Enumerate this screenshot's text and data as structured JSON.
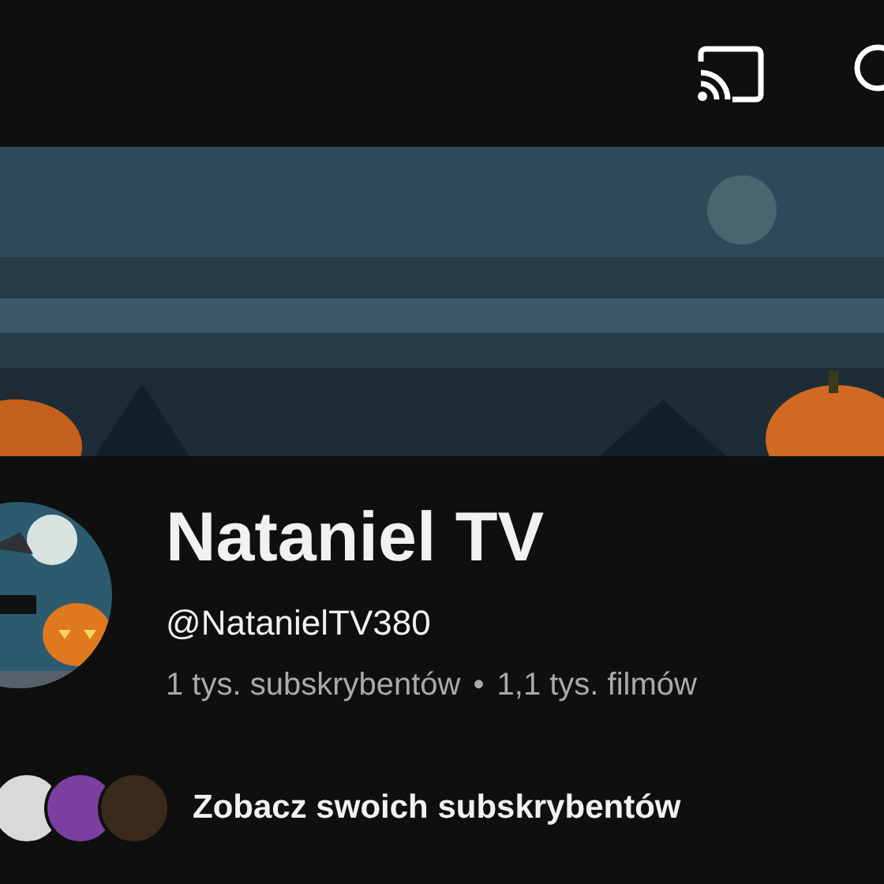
{
  "channel": {
    "name": "Nataniel TV",
    "handle": "@NatanielTV380",
    "subscribers": "1 tys. subskrybentów",
    "separator": "•",
    "videos": "1,1 tys. filmów"
  },
  "subscribers_link": "Zobacz swoich subskrybentów"
}
